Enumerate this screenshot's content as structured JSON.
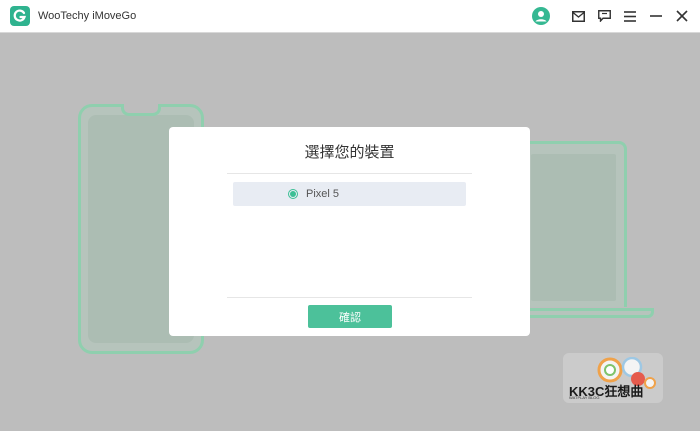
{
  "app": {
    "title": "WooTechy iMoveGo",
    "accent_color": "#2fb38f"
  },
  "titlebar": {
    "icons": [
      "user-avatar-icon",
      "mail-icon",
      "feedback-icon",
      "menu-icon",
      "minimize-icon",
      "close-icon"
    ]
  },
  "dialog": {
    "title": "選擇您的裝置",
    "devices": [
      {
        "label": "Pixel 5",
        "selected": true
      }
    ],
    "confirm_label": "確認",
    "confirm_color": "#4cc19a"
  },
  "watermark": {
    "text": "KK3C狂想曲",
    "small_text": "WATPLAY BLOG"
  }
}
